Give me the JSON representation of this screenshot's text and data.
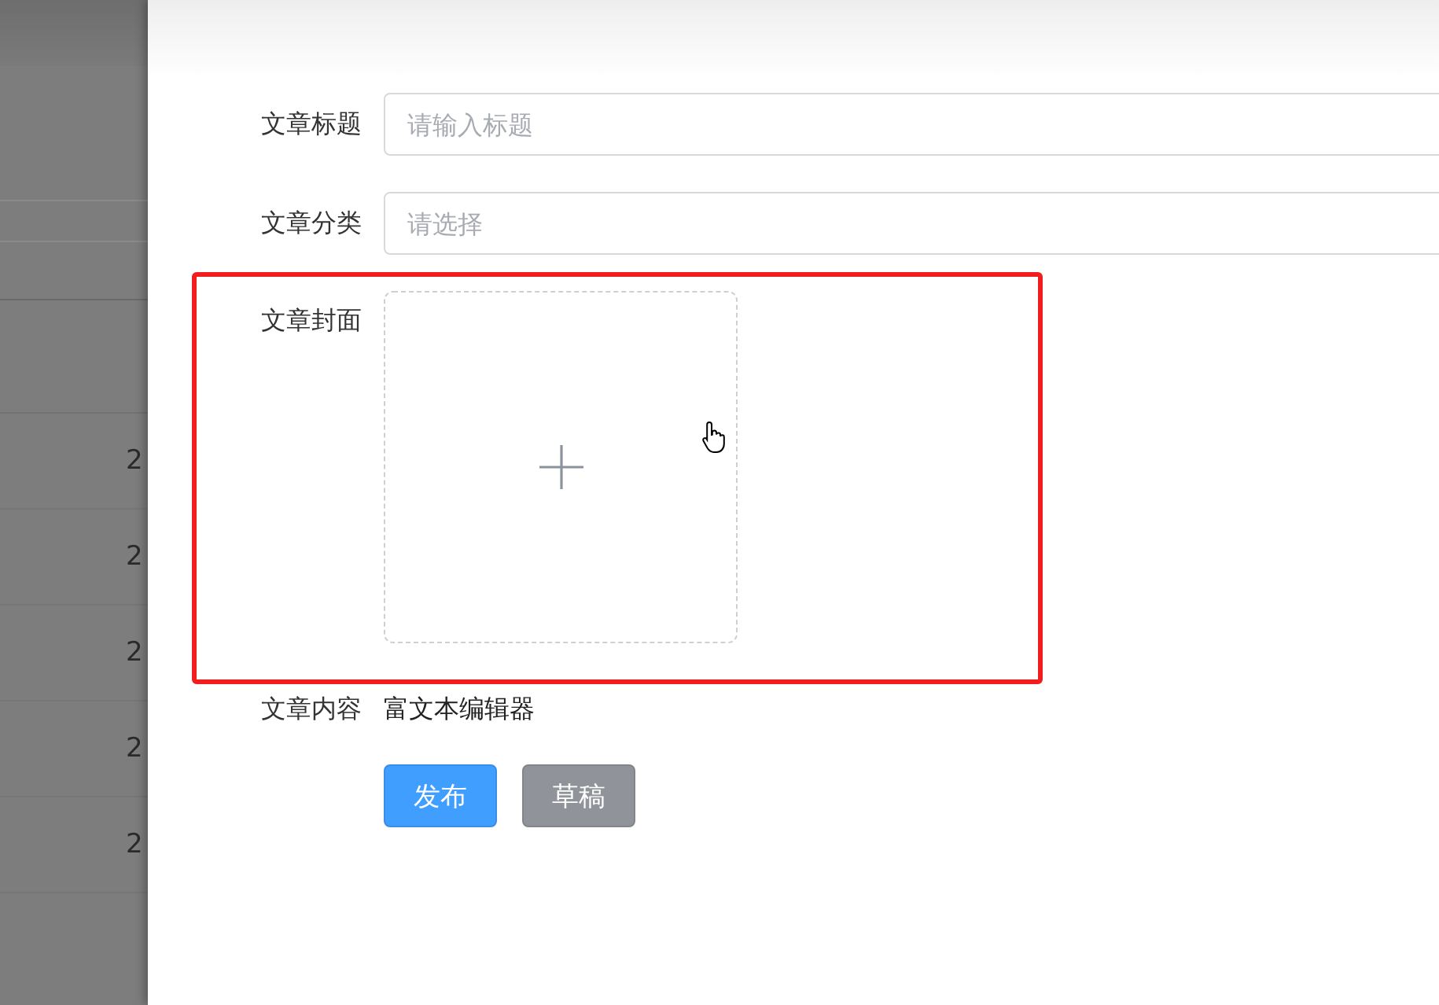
{
  "background_table": {
    "rows": [
      "2",
      "2",
      "2",
      "2",
      "2"
    ]
  },
  "drawer": {
    "form": {
      "fields": [
        {
          "kind": "input",
          "label": "文章标题",
          "placeholder": "请输入标题"
        },
        {
          "kind": "select",
          "label": "文章分类",
          "placeholder": "请选择"
        },
        {
          "kind": "upload",
          "label": "文章封面"
        },
        {
          "kind": "text",
          "label": "文章内容",
          "value": "富文本编辑器"
        }
      ]
    },
    "buttons": [
      {
        "kind": "primary",
        "label": "发布"
      },
      {
        "kind": "secondary",
        "label": "草稿"
      }
    ]
  }
}
